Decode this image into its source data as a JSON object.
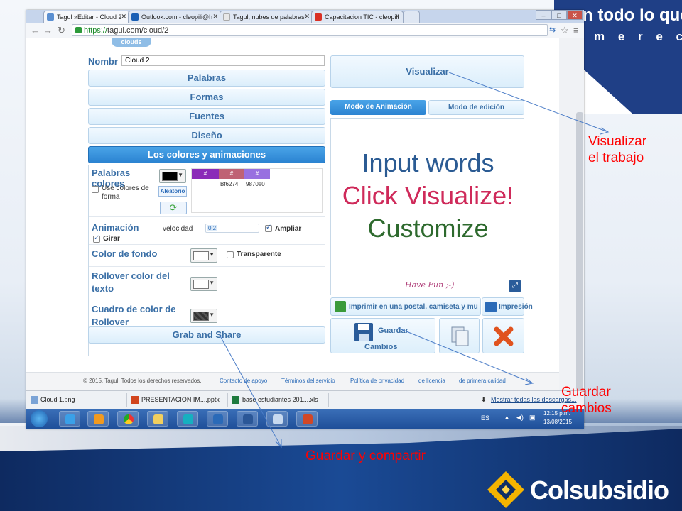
{
  "slide": {
    "slogan_line1": "n todo lo que",
    "slogan_line2": "m e r e c e s",
    "logo_text": "Colsubsidio"
  },
  "browser": {
    "tabs": [
      {
        "label": "Tagul »Editar - Cloud 2",
        "active": true
      },
      {
        "label": "Outlook.com - cleopili@h",
        "active": false
      },
      {
        "label": "Tagul, nubes de palabras",
        "active": false
      },
      {
        "label": "Capacitacion TIC - cleopili",
        "active": false
      }
    ],
    "url_scheme": "https://",
    "url_rest": "tagul.com/cloud/2",
    "win_min": "–",
    "win_max": "□",
    "win_close": "✕"
  },
  "editor": {
    "header_logo": "clouds",
    "name_label": "Nombr",
    "name_value": "Cloud 2",
    "sections": [
      "Palabras",
      "Formas",
      "Fuentes",
      "Diseño"
    ],
    "active_section": "Los colores y animaciones",
    "palabras_colores_label": "Palabras colores",
    "use_shape_colors": "Use colores de forma",
    "random_button": "Aleatorio",
    "color_rows": [
      {
        "hash": "#",
        "code": "",
        "color": "#8b2bb8"
      },
      {
        "hash": "#",
        "code": "Bf6274",
        "color": "#bf6274"
      },
      {
        "hash": "#",
        "code": "9870e0",
        "color": "#9870e0"
      }
    ],
    "animation_label": "Animación",
    "velocity_label": "velocidad",
    "velocity_value": "0.2",
    "zoom_label": "Ampliar",
    "rotate_label": "Girar",
    "bg_color_label": "Color de fondo",
    "transparent_label": "Transparente",
    "rollover_text_label": "Rollover color del texto",
    "rollover_box_label": "Cuadro de color de Rollover",
    "grab_share": "Grab and Share"
  },
  "preview": {
    "visualize_button": "Visualizar",
    "mode_animation": "Modo de Animación",
    "mode_edit": "Modo de edición",
    "line1": "Input words",
    "line2": "Click Visualize!",
    "line3": "Customize",
    "have_fun": "Have Fun ;-)",
    "print_postal": "Imprimir en una postal, camiseta y mu",
    "print": "Impresión",
    "save_line1": "Guardar",
    "save_line2": "Cambios",
    "colors": {
      "line1": "#2b5b93",
      "line2": "#cf2a5a",
      "line3": "#2e6a2e"
    }
  },
  "footer": {
    "copyright": "© 2015. Tagul. Todos los derechos reservados.",
    "links": [
      "Contacto de apoyo",
      "Términos del servicio",
      "Política de privacidad",
      "de licencia",
      "de primera calidad"
    ]
  },
  "downloads": {
    "items": [
      "Cloud 1.png",
      "PRESENTACION IM....pptx",
      "base estudiantes 201....xls"
    ],
    "show_all": "Mostrar todas las descargas..."
  },
  "taskbar": {
    "lang": "ES",
    "time": "12:15 p.m.",
    "date": "13/08/2015"
  },
  "annotations": {
    "visualizar": "Visualizar\nel trabajo",
    "guardar_cambios": "Guardar\ncambios",
    "guardar_compartir": "Guardar y compartir"
  }
}
